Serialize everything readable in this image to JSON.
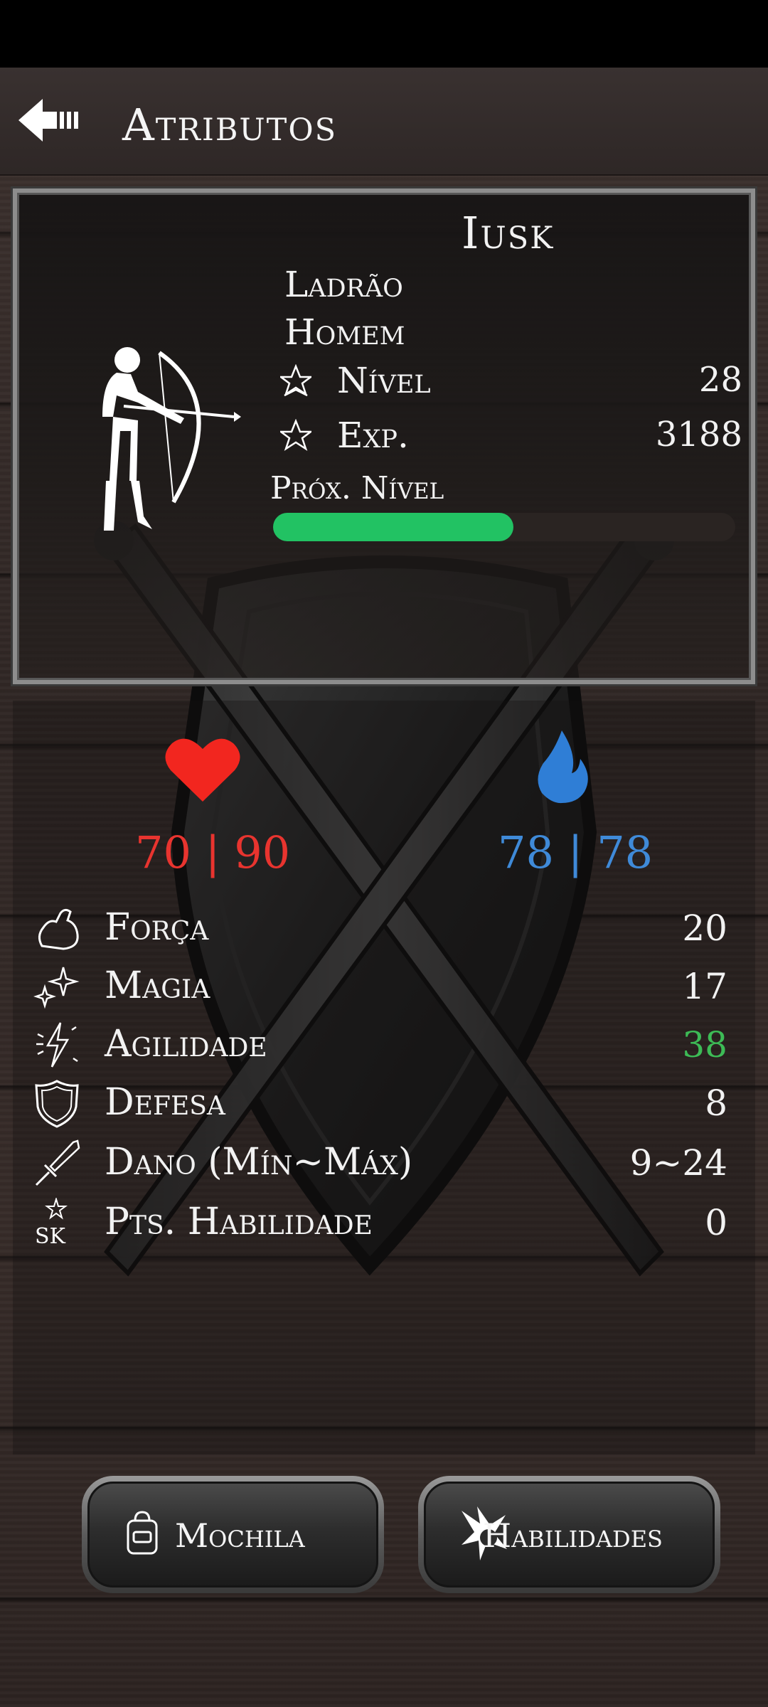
{
  "header": {
    "title": "Atributos",
    "back_icon": "back-arrow-icon"
  },
  "character": {
    "name": "Iusk",
    "class": "Ladrão",
    "gender": "Homem",
    "level_label": "Nível",
    "level_value": "28",
    "exp_label": "Exp.",
    "exp_value": "3188",
    "next_level_label": "Próx. Nível",
    "next_level_progress": 0.52,
    "avatar_icon": "archer-icon"
  },
  "vitals": {
    "hp": "70 | 90",
    "mp": "78 | 78",
    "hp_color": "#e8342f",
    "mp_color": "#3f8ad8"
  },
  "attributes": [
    {
      "label": "Força",
      "value": "20",
      "icon": "strength-icon",
      "color": "#f2f2f2"
    },
    {
      "label": "Magia",
      "value": "17",
      "icon": "magic-sparkle-icon",
      "color": "#f2f2f2"
    },
    {
      "label": "Agilidade",
      "value": "38",
      "icon": "agility-icon",
      "color": "#3dbb56"
    },
    {
      "label": "Defesa",
      "value": "8",
      "icon": "shield-icon",
      "color": "#f2f2f2"
    },
    {
      "label": "Dano (Mín~Máx)",
      "value": "9~24",
      "icon": "sword-icon",
      "color": "#f2f2f2"
    },
    {
      "label": "Pts. Habilidade",
      "value": "0",
      "icon": "skill-points-icon",
      "color": "#f2f2f2"
    }
  ],
  "buttons": {
    "backpack": "Mochila",
    "skills": "Habilidades"
  }
}
